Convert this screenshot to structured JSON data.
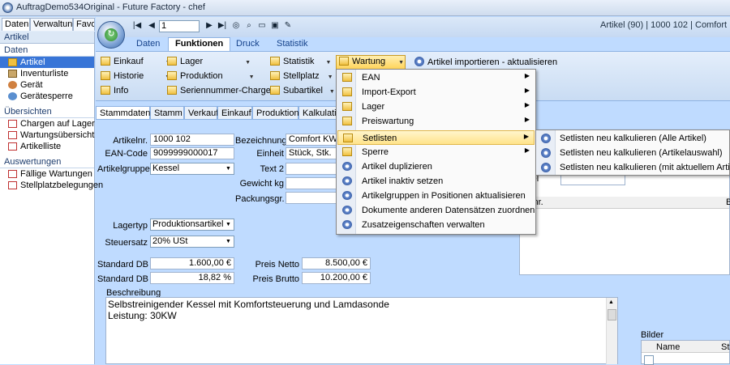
{
  "window": {
    "title": "AuftragDemo534Original - Future Factory - chef"
  },
  "left_tabs": [
    "Daten",
    "Verwaltung",
    "Favo"
  ],
  "left_nav": {
    "header": "Artikel",
    "sections": [
      {
        "title": "Daten",
        "items": [
          "Artikel",
          "Inventurliste",
          "Gerät",
          "Gerätesperre"
        ]
      },
      {
        "title": "Übersichten",
        "items": [
          "Chargen auf Lager",
          "Wartungsübersicht",
          "Artikelliste"
        ]
      },
      {
        "title": "Auswertungen",
        "items": [
          "Fällige Wartungen",
          "Stellplatzbelegungen"
        ]
      }
    ],
    "selected": "Artikel"
  },
  "toolbar": {
    "record_number": "1",
    "header_info": "Artikel  (90) | 1000 102 | Comfort KW"
  },
  "ribbon_tabs": [
    "Daten",
    "Funktionen",
    "Druck",
    "Statistik"
  ],
  "ribbon": {
    "col1": [
      "Einkauf",
      "Historie",
      "Info"
    ],
    "col2": [
      "Lager",
      "Produktion",
      "Seriennummer-Charge"
    ],
    "col3": [
      "Statistik",
      "Stellplatz",
      "Subartikel"
    ],
    "wartung": "Wartung",
    "artikel_import": "Artikel importieren - aktualisieren"
  },
  "sub_tabs": [
    "Stammdaten",
    "Stamm 2",
    "Verkauf",
    "Einkauf",
    "Produktion",
    "Kalkulatio"
  ],
  "form": {
    "artikelnr_label": "Artikelnr.",
    "artikelnr": "1000 102",
    "ean_label": "EAN-Code",
    "ean": "9099999000017",
    "artikelgruppe_label": "Artikelgruppe",
    "artikelgruppe": "Kessel",
    "bezeichnung_label": "Bezeichnung",
    "bezeichnung": "Comfort KW30",
    "einheit_label": "Einheit",
    "einheit": "Stück, Stk.",
    "text2_label": "Text 2",
    "gewicht_label": "Gewicht kg",
    "packungsgr_label": "Packungsgr.",
    "lagertyp_label": "Lagertyp",
    "lagertyp": "Produktionsartikel",
    "steuersatz_label": "Steuersatz",
    "steuersatz": "20% USt",
    "standard_db_label": "Standard DB",
    "standard_db": "1.600,00 €",
    "standard_db_pct_label": "Standard DB %",
    "standard_db_pct": "18,82 %",
    "preis_netto_label": "Preis Netto",
    "preis_netto": "8.500,00 €",
    "preis_brutto_label": "Preis Brutto",
    "preis_brutto": "10.200,00 €",
    "beschreibung_label": "Beschreibung",
    "beschreibung_line1": "Selbstreinigender Kessel mit Komfortsteuerung und Lamdasonde",
    "beschreibung_line2": "Leistung: 30KW"
  },
  "right_panel": {
    "label1": "rtikel",
    "label2": "tikel",
    "col_artikelnr": "ikelnr.",
    "col_b": "B"
  },
  "bilder": {
    "label": "Bilder",
    "col_name": "Name",
    "col_sti": "Sti"
  },
  "menu": {
    "items": [
      {
        "label": "EAN",
        "submenu": true
      },
      {
        "label": "Import-Export",
        "submenu": true
      },
      {
        "label": "Lager",
        "submenu": true
      },
      {
        "label": "Preiswartung",
        "submenu": true
      },
      {
        "label": "Setlisten",
        "submenu": true
      },
      {
        "label": "Sperre",
        "submenu": true
      },
      {
        "label": "Artikel duplizieren",
        "submenu": false
      },
      {
        "label": "Artikel inaktiv setzen",
        "submenu": false
      },
      {
        "label": "Artikelgruppen in Positionen aktualisieren",
        "submenu": false
      },
      {
        "label": "Dokumente anderen Datensätzen zuordnen",
        "submenu": false
      },
      {
        "label": "Zusatzeigenschaften verwalten",
        "submenu": false
      }
    ],
    "highlighted": "Setlisten"
  },
  "submenu": {
    "items": [
      "Setlisten neu kalkulieren (Alle Artikel)",
      "Setlisten neu kalkulieren (Artikelauswahl)",
      "Setlisten neu kalkulieren (mit aktuellem Artikel)"
    ]
  },
  "colors": {
    "accent": "#3875d7",
    "highlight": "#ffe38a",
    "background": "#bfdbff"
  }
}
